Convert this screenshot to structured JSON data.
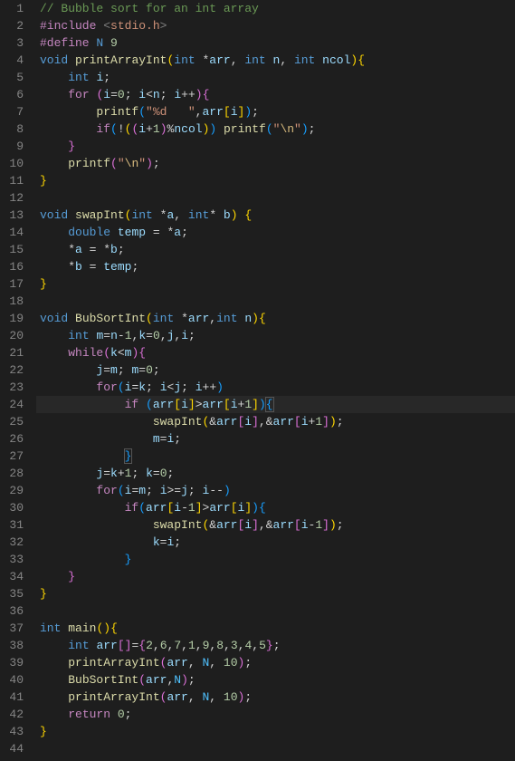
{
  "lineCount": 44,
  "tokens": {
    "1": [
      [
        "comment",
        "// Bubble sort for an int array"
      ]
    ],
    "2": [
      [
        "keyword",
        "#include"
      ],
      [
        "punct",
        " "
      ],
      [
        "angle",
        "<"
      ],
      [
        "incfile",
        "stdio.h"
      ],
      [
        "angle",
        ">"
      ]
    ],
    "3": [
      [
        "keyword",
        "#define"
      ],
      [
        "punct",
        " "
      ],
      [
        "macro",
        "N"
      ],
      [
        "punct",
        " "
      ],
      [
        "number",
        "9"
      ]
    ],
    "4": [
      [
        "type",
        "void"
      ],
      [
        "punct",
        " "
      ],
      [
        "func",
        "printArrayInt"
      ],
      [
        "bracket-y",
        "("
      ],
      [
        "type",
        "int"
      ],
      [
        "punct",
        " "
      ],
      [
        "punct",
        "*"
      ],
      [
        "var",
        "arr"
      ],
      [
        "punct",
        ", "
      ],
      [
        "type",
        "int"
      ],
      [
        "punct",
        " "
      ],
      [
        "var",
        "n"
      ],
      [
        "punct",
        ", "
      ],
      [
        "type",
        "int"
      ],
      [
        "punct",
        " "
      ],
      [
        "var",
        "ncol"
      ],
      [
        "bracket-y",
        ")"
      ],
      [
        "bracket-y",
        "{"
      ]
    ],
    "5": [
      [
        "punct",
        "    "
      ],
      [
        "type",
        "int"
      ],
      [
        "punct",
        " "
      ],
      [
        "var",
        "i"
      ],
      [
        "punct",
        ";"
      ]
    ],
    "6": [
      [
        "punct",
        "    "
      ],
      [
        "keyword",
        "for"
      ],
      [
        "punct",
        " "
      ],
      [
        "bracket-p",
        "("
      ],
      [
        "var",
        "i"
      ],
      [
        "punct",
        "="
      ],
      [
        "number",
        "0"
      ],
      [
        "punct",
        "; "
      ],
      [
        "var",
        "i"
      ],
      [
        "punct",
        "<"
      ],
      [
        "var",
        "n"
      ],
      [
        "punct",
        "; "
      ],
      [
        "var",
        "i"
      ],
      [
        "punct",
        "++"
      ],
      [
        "bracket-p",
        ")"
      ],
      [
        "bracket-p",
        "{"
      ]
    ],
    "7": [
      [
        "punct",
        "        "
      ],
      [
        "func",
        "printf"
      ],
      [
        "bracket-b",
        "("
      ],
      [
        "string",
        "\"%d   \""
      ],
      [
        "punct",
        ","
      ],
      [
        "var",
        "arr"
      ],
      [
        "bracket-y",
        "["
      ],
      [
        "var",
        "i"
      ],
      [
        "bracket-y",
        "]"
      ],
      [
        "bracket-b",
        ")"
      ],
      [
        "punct",
        ";"
      ]
    ],
    "8": [
      [
        "punct",
        "        "
      ],
      [
        "keyword",
        "if"
      ],
      [
        "bracket-b",
        "("
      ],
      [
        "punct",
        "!"
      ],
      [
        "bracket-y",
        "("
      ],
      [
        "bracket-p",
        "("
      ],
      [
        "var",
        "i"
      ],
      [
        "punct",
        "+"
      ],
      [
        "number",
        "1"
      ],
      [
        "bracket-p",
        ")"
      ],
      [
        "punct",
        "%"
      ],
      [
        "var",
        "ncol"
      ],
      [
        "bracket-y",
        ")"
      ],
      [
        "bracket-b",
        ")"
      ],
      [
        "punct",
        " "
      ],
      [
        "func",
        "printf"
      ],
      [
        "bracket-b",
        "("
      ],
      [
        "string",
        "\""
      ],
      [
        "escape",
        "\\n"
      ],
      [
        "string",
        "\""
      ],
      [
        "bracket-b",
        ")"
      ],
      [
        "punct",
        ";"
      ]
    ],
    "9": [
      [
        "punct",
        "    "
      ],
      [
        "bracket-p",
        "}"
      ]
    ],
    "10": [
      [
        "punct",
        "    "
      ],
      [
        "func",
        "printf"
      ],
      [
        "bracket-p",
        "("
      ],
      [
        "string",
        "\""
      ],
      [
        "escape",
        "\\n"
      ],
      [
        "string",
        "\""
      ],
      [
        "bracket-p",
        ")"
      ],
      [
        "punct",
        ";"
      ]
    ],
    "11": [
      [
        "bracket-y",
        "}"
      ]
    ],
    "12": [],
    "13": [
      [
        "type",
        "void"
      ],
      [
        "punct",
        " "
      ],
      [
        "func",
        "swapInt"
      ],
      [
        "bracket-y",
        "("
      ],
      [
        "type",
        "int"
      ],
      [
        "punct",
        " "
      ],
      [
        "punct",
        "*"
      ],
      [
        "var",
        "a"
      ],
      [
        "punct",
        ", "
      ],
      [
        "type",
        "int"
      ],
      [
        "punct",
        "* "
      ],
      [
        "var",
        "b"
      ],
      [
        "bracket-y",
        ")"
      ],
      [
        "punct",
        " "
      ],
      [
        "bracket-y",
        "{"
      ]
    ],
    "14": [
      [
        "punct",
        "    "
      ],
      [
        "type",
        "double"
      ],
      [
        "punct",
        " "
      ],
      [
        "var",
        "temp"
      ],
      [
        "punct",
        " = *"
      ],
      [
        "var",
        "a"
      ],
      [
        "punct",
        ";"
      ]
    ],
    "15": [
      [
        "punct",
        "    *"
      ],
      [
        "var",
        "a"
      ],
      [
        "punct",
        " = *"
      ],
      [
        "var",
        "b"
      ],
      [
        "punct",
        ";"
      ]
    ],
    "16": [
      [
        "punct",
        "    *"
      ],
      [
        "var",
        "b"
      ],
      [
        "punct",
        " = "
      ],
      [
        "var",
        "temp"
      ],
      [
        "punct",
        ";"
      ]
    ],
    "17": [
      [
        "bracket-y",
        "}"
      ]
    ],
    "18": [],
    "19": [
      [
        "type",
        "void"
      ],
      [
        "punct",
        " "
      ],
      [
        "func",
        "BubSortInt"
      ],
      [
        "bracket-y",
        "("
      ],
      [
        "type",
        "int"
      ],
      [
        "punct",
        " "
      ],
      [
        "punct",
        "*"
      ],
      [
        "var",
        "arr"
      ],
      [
        "punct",
        ","
      ],
      [
        "type",
        "int"
      ],
      [
        "punct",
        " "
      ],
      [
        "var",
        "n"
      ],
      [
        "bracket-y",
        ")"
      ],
      [
        "bracket-y",
        "{"
      ]
    ],
    "20": [
      [
        "punct",
        "    "
      ],
      [
        "type",
        "int"
      ],
      [
        "punct",
        " "
      ],
      [
        "var",
        "m"
      ],
      [
        "punct",
        "="
      ],
      [
        "var",
        "n"
      ],
      [
        "punct",
        "-"
      ],
      [
        "number",
        "1"
      ],
      [
        "punct",
        ","
      ],
      [
        "var",
        "k"
      ],
      [
        "punct",
        "="
      ],
      [
        "number",
        "0"
      ],
      [
        "punct",
        ","
      ],
      [
        "var",
        "j"
      ],
      [
        "punct",
        ","
      ],
      [
        "var",
        "i"
      ],
      [
        "punct",
        ";"
      ]
    ],
    "21": [
      [
        "punct",
        "    "
      ],
      [
        "keyword",
        "while"
      ],
      [
        "bracket-p",
        "("
      ],
      [
        "var",
        "k"
      ],
      [
        "punct",
        "<"
      ],
      [
        "var",
        "m"
      ],
      [
        "bracket-p",
        ")"
      ],
      [
        "bracket-p",
        "{"
      ]
    ],
    "22": [
      [
        "punct",
        "        "
      ],
      [
        "var",
        "j"
      ],
      [
        "punct",
        "="
      ],
      [
        "var",
        "m"
      ],
      [
        "punct",
        "; "
      ],
      [
        "var",
        "m"
      ],
      [
        "punct",
        "="
      ],
      [
        "number",
        "0"
      ],
      [
        "punct",
        ";"
      ]
    ],
    "23": [
      [
        "punct",
        "        "
      ],
      [
        "keyword",
        "for"
      ],
      [
        "bracket-b",
        "("
      ],
      [
        "var",
        "i"
      ],
      [
        "punct",
        "="
      ],
      [
        "var",
        "k"
      ],
      [
        "punct",
        "; "
      ],
      [
        "var",
        "i"
      ],
      [
        "punct",
        "<"
      ],
      [
        "var",
        "j"
      ],
      [
        "punct",
        "; "
      ],
      [
        "var",
        "i"
      ],
      [
        "punct",
        "++"
      ],
      [
        "bracket-b",
        ")"
      ]
    ],
    "24": [
      [
        "punct",
        "            "
      ],
      [
        "keyword",
        "if"
      ],
      [
        "punct",
        " "
      ],
      [
        "bracket-b",
        "("
      ],
      [
        "var",
        "arr"
      ],
      [
        "bracket-y",
        "["
      ],
      [
        "var",
        "i"
      ],
      [
        "bracket-y",
        "]"
      ],
      [
        "punct",
        ">"
      ],
      [
        "var",
        "arr"
      ],
      [
        "bracket-y",
        "["
      ],
      [
        "var",
        "i"
      ],
      [
        "punct",
        "+"
      ],
      [
        "number",
        "1"
      ],
      [
        "bracket-y",
        "]"
      ],
      [
        "bracket-b",
        ")"
      ],
      [
        "bracket-b brace-hl",
        "{"
      ]
    ],
    "25": [
      [
        "punct",
        "                "
      ],
      [
        "func",
        "swapInt"
      ],
      [
        "bracket-y",
        "("
      ],
      [
        "punct",
        "&"
      ],
      [
        "var",
        "arr"
      ],
      [
        "bracket-p",
        "["
      ],
      [
        "var",
        "i"
      ],
      [
        "bracket-p",
        "]"
      ],
      [
        "punct",
        ",&"
      ],
      [
        "var",
        "arr"
      ],
      [
        "bracket-p",
        "["
      ],
      [
        "var",
        "i"
      ],
      [
        "punct",
        "+"
      ],
      [
        "number",
        "1"
      ],
      [
        "bracket-p",
        "]"
      ],
      [
        "bracket-y",
        ")"
      ],
      [
        "punct",
        ";"
      ]
    ],
    "26": [
      [
        "punct",
        "                "
      ],
      [
        "var",
        "m"
      ],
      [
        "punct",
        "="
      ],
      [
        "var",
        "i"
      ],
      [
        "punct",
        ";"
      ]
    ],
    "27": [
      [
        "punct",
        "            "
      ],
      [
        "bracket-b brace-hl",
        "}"
      ]
    ],
    "28": [
      [
        "punct",
        "        "
      ],
      [
        "var",
        "j"
      ],
      [
        "punct",
        "="
      ],
      [
        "var",
        "k"
      ],
      [
        "punct",
        "+"
      ],
      [
        "number",
        "1"
      ],
      [
        "punct",
        "; "
      ],
      [
        "var",
        "k"
      ],
      [
        "punct",
        "="
      ],
      [
        "number",
        "0"
      ],
      [
        "punct",
        ";"
      ]
    ],
    "29": [
      [
        "punct",
        "        "
      ],
      [
        "keyword",
        "for"
      ],
      [
        "bracket-b",
        "("
      ],
      [
        "var",
        "i"
      ],
      [
        "punct",
        "="
      ],
      [
        "var",
        "m"
      ],
      [
        "punct",
        "; "
      ],
      [
        "var",
        "i"
      ],
      [
        "punct",
        ">="
      ],
      [
        "var",
        "j"
      ],
      [
        "punct",
        "; "
      ],
      [
        "var",
        "i"
      ],
      [
        "punct",
        "--"
      ],
      [
        "bracket-b",
        ")"
      ]
    ],
    "30": [
      [
        "punct",
        "            "
      ],
      [
        "keyword",
        "if"
      ],
      [
        "bracket-b",
        "("
      ],
      [
        "var",
        "arr"
      ],
      [
        "bracket-y",
        "["
      ],
      [
        "var",
        "i"
      ],
      [
        "punct",
        "-"
      ],
      [
        "number",
        "1"
      ],
      [
        "bracket-y",
        "]"
      ],
      [
        "punct",
        ">"
      ],
      [
        "var",
        "arr"
      ],
      [
        "bracket-y",
        "["
      ],
      [
        "var",
        "i"
      ],
      [
        "bracket-y",
        "]"
      ],
      [
        "bracket-b",
        ")"
      ],
      [
        "bracket-b",
        "{"
      ]
    ],
    "31": [
      [
        "punct",
        "                "
      ],
      [
        "func",
        "swapInt"
      ],
      [
        "bracket-y",
        "("
      ],
      [
        "punct",
        "&"
      ],
      [
        "var",
        "arr"
      ],
      [
        "bracket-p",
        "["
      ],
      [
        "var",
        "i"
      ],
      [
        "bracket-p",
        "]"
      ],
      [
        "punct",
        ",&"
      ],
      [
        "var",
        "arr"
      ],
      [
        "bracket-p",
        "["
      ],
      [
        "var",
        "i"
      ],
      [
        "punct",
        "-"
      ],
      [
        "number",
        "1"
      ],
      [
        "bracket-p",
        "]"
      ],
      [
        "bracket-y",
        ")"
      ],
      [
        "punct",
        ";"
      ]
    ],
    "32": [
      [
        "punct",
        "                "
      ],
      [
        "var",
        "k"
      ],
      [
        "punct",
        "="
      ],
      [
        "var",
        "i"
      ],
      [
        "punct",
        ";"
      ]
    ],
    "33": [
      [
        "punct",
        "            "
      ],
      [
        "bracket-b",
        "}"
      ]
    ],
    "34": [
      [
        "punct",
        "    "
      ],
      [
        "bracket-p",
        "}"
      ]
    ],
    "35": [
      [
        "bracket-y",
        "}"
      ]
    ],
    "36": [],
    "37": [
      [
        "type",
        "int"
      ],
      [
        "punct",
        " "
      ],
      [
        "func",
        "main"
      ],
      [
        "bracket-y",
        "("
      ],
      [
        "bracket-y",
        ")"
      ],
      [
        "bracket-y",
        "{"
      ]
    ],
    "38": [
      [
        "punct",
        "    "
      ],
      [
        "type",
        "int"
      ],
      [
        "punct",
        " "
      ],
      [
        "var",
        "arr"
      ],
      [
        "bracket-p",
        "["
      ],
      [
        "bracket-p",
        "]"
      ],
      [
        "punct",
        "="
      ],
      [
        "bracket-p",
        "{"
      ],
      [
        "number",
        "2"
      ],
      [
        "punct",
        ","
      ],
      [
        "number",
        "6"
      ],
      [
        "punct",
        ","
      ],
      [
        "number",
        "7"
      ],
      [
        "punct",
        ","
      ],
      [
        "number",
        "1"
      ],
      [
        "punct",
        ","
      ],
      [
        "number",
        "9"
      ],
      [
        "punct",
        ","
      ],
      [
        "number",
        "8"
      ],
      [
        "punct",
        ","
      ],
      [
        "number",
        "3"
      ],
      [
        "punct",
        ","
      ],
      [
        "number",
        "4"
      ],
      [
        "punct",
        ","
      ],
      [
        "number",
        "5"
      ],
      [
        "bracket-p",
        "}"
      ],
      [
        "punct",
        ";"
      ]
    ],
    "39": [
      [
        "punct",
        "    "
      ],
      [
        "func",
        "printArrayInt"
      ],
      [
        "bracket-p",
        "("
      ],
      [
        "var",
        "arr"
      ],
      [
        "punct",
        ", "
      ],
      [
        "const",
        "N"
      ],
      [
        "punct",
        ", "
      ],
      [
        "number",
        "10"
      ],
      [
        "bracket-p",
        ")"
      ],
      [
        "punct",
        ";"
      ]
    ],
    "40": [
      [
        "punct",
        "    "
      ],
      [
        "func",
        "BubSortInt"
      ],
      [
        "bracket-p",
        "("
      ],
      [
        "var",
        "arr"
      ],
      [
        "punct",
        ","
      ],
      [
        "const",
        "N"
      ],
      [
        "bracket-p",
        ")"
      ],
      [
        "punct",
        ";"
      ]
    ],
    "41": [
      [
        "punct",
        "    "
      ],
      [
        "func",
        "printArrayInt"
      ],
      [
        "bracket-p",
        "("
      ],
      [
        "var",
        "arr"
      ],
      [
        "punct",
        ", "
      ],
      [
        "const",
        "N"
      ],
      [
        "punct",
        ", "
      ],
      [
        "number",
        "10"
      ],
      [
        "bracket-p",
        ")"
      ],
      [
        "punct",
        ";"
      ]
    ],
    "42": [
      [
        "punct",
        "    "
      ],
      [
        "keyword",
        "return"
      ],
      [
        "punct",
        " "
      ],
      [
        "number",
        "0"
      ],
      [
        "punct",
        ";"
      ]
    ],
    "43": [
      [
        "bracket-y",
        "}"
      ]
    ],
    "44": []
  }
}
